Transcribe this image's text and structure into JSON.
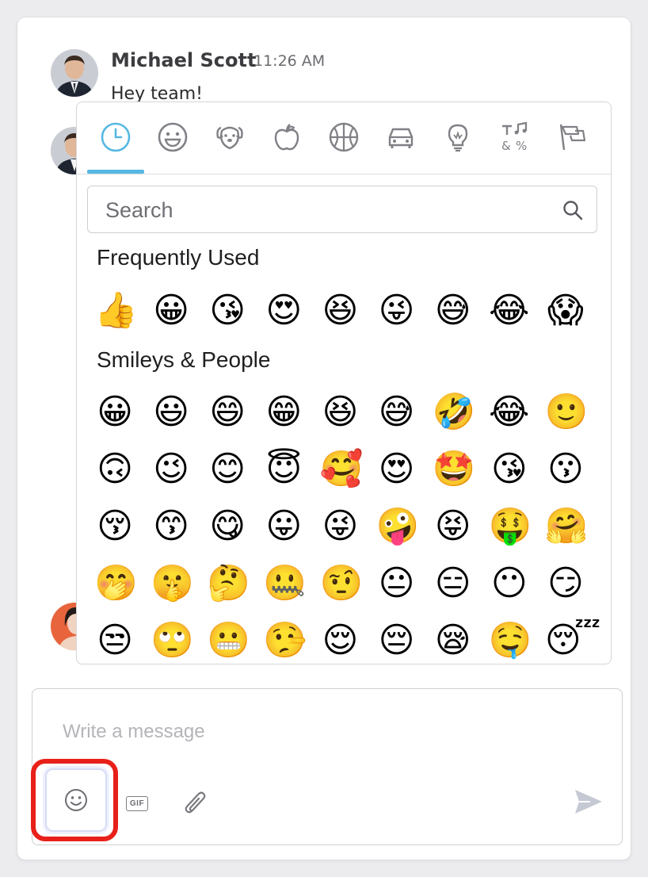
{
  "message": {
    "author": "Michael Scott",
    "time": "11:26 AM",
    "text": "Hey team!"
  },
  "emoji_picker": {
    "tabs": [
      {
        "name": "recent",
        "icon": "clock-icon",
        "active": true
      },
      {
        "name": "smileys",
        "icon": "smiley-icon"
      },
      {
        "name": "animals",
        "icon": "dog-icon"
      },
      {
        "name": "food",
        "icon": "apple-icon"
      },
      {
        "name": "activity",
        "icon": "basketball-icon"
      },
      {
        "name": "travel",
        "icon": "car-icon"
      },
      {
        "name": "objects",
        "icon": "lightbulb-icon"
      },
      {
        "name": "symbols",
        "icon": "symbols-icon"
      },
      {
        "name": "flags",
        "icon": "flag-icon"
      }
    ],
    "search_placeholder": "Search",
    "sections": [
      {
        "title": "Frequently Used",
        "rows": [
          [
            "👍",
            "😀",
            "😘",
            "😍",
            "😆",
            "😜",
            "😅",
            "😂",
            "😱"
          ]
        ]
      },
      {
        "title": "Smileys & People",
        "rows": [
          [
            "😀",
            "😃",
            "😄",
            "😁",
            "😆",
            "😅",
            "🤣",
            "😂",
            "🙂"
          ],
          [
            "🙃",
            "😉",
            "😊",
            "😇",
            "🥰",
            "😍",
            "🤩",
            "😘",
            "😗"
          ],
          [
            "😚",
            "😙",
            "😋",
            "😛",
            "😜",
            "🤪",
            "😝",
            "🤑",
            "🤗"
          ],
          [
            "🤭",
            "🤫",
            "🤔",
            "🤐",
            "🤨",
            "😐",
            "😑",
            "😶",
            "😏"
          ],
          [
            "😒",
            "🙄",
            "😬",
            "🤥",
            "😌",
            "😔",
            "😪",
            "🤤",
            "😴"
          ]
        ]
      }
    ]
  },
  "composer": {
    "placeholder": "Write a message",
    "gif_label": "GIF",
    "accent_highlight": "#e8201a",
    "active_tab_color": "#56b8e2"
  }
}
